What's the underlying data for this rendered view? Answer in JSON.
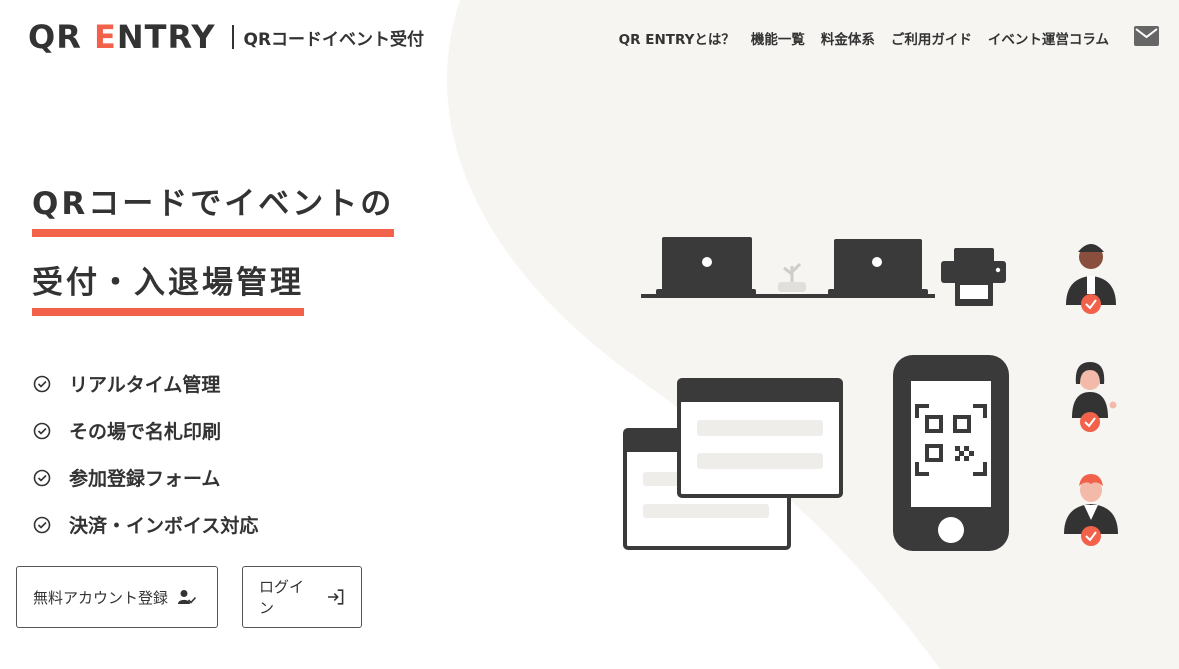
{
  "header": {
    "logo_prefix": "QR ",
    "logo_accent": "E",
    "logo_suffix": "NTRY",
    "logo_sub": "QRコードイベント受付",
    "nav": [
      "QR ENTRYとは？",
      "機能一覧",
      "料金体系",
      "ご利用ガイド",
      "イベント運営コラム"
    ]
  },
  "hero": {
    "line1": "QRコードでイベントの",
    "line2": "受付・入退場管理"
  },
  "features": [
    "リアルタイム管理",
    "その場で名札印刷",
    "参加登録フォーム",
    "決済・インボイス対応"
  ],
  "buttons": {
    "register": "無料アカウント登録",
    "login": "ログイン"
  },
  "colors": {
    "accent": "#f2614a",
    "dark": "#3a3a3a",
    "blob": "#f6f5f2"
  }
}
